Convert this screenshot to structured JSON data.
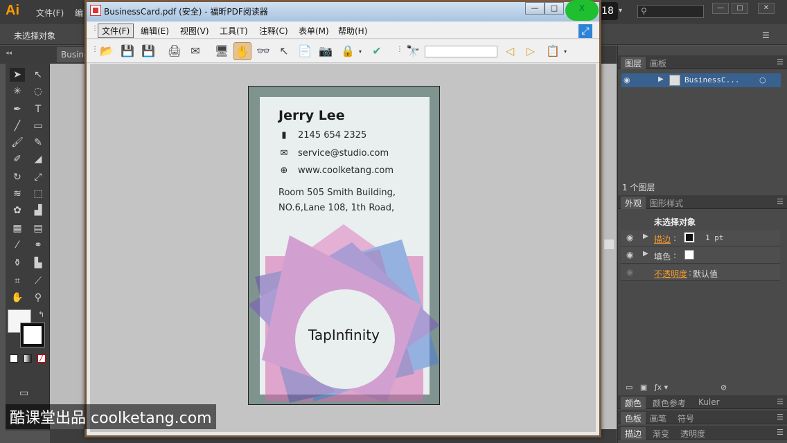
{
  "illustrator": {
    "logo": "Ai",
    "menus": [
      "文件(F)",
      "编"
    ],
    "counter": "18",
    "control_bar": {
      "no_selection": "未选择对象"
    },
    "doc_tab": "Busine",
    "tools": [
      "selection",
      "direct-selection",
      "magic-wand",
      "lasso",
      "pen",
      "type",
      "line",
      "rectangle",
      "paintbrush",
      "pencil",
      "blob-brush",
      "eraser",
      "rotate",
      "scale",
      "warp",
      "free-transform",
      "symbol-sprayer",
      "column-graph",
      "mesh",
      "gradient",
      "eyedropper",
      "blend",
      "live-paint",
      "graph",
      "artboard",
      "slice",
      "hand",
      "zoom"
    ],
    "layers_panel": {
      "tabs": [
        "图层",
        "画板"
      ],
      "layer_name": "BusinessC...",
      "count": "1 个图层"
    },
    "appearance_panel": {
      "tabs": [
        "外观",
        "图形样式"
      ],
      "title": "未选择对象",
      "stroke_label": "描边",
      "stroke_value": "1 pt",
      "fill_label": "填色",
      "opacity_label": "不透明度",
      "opacity_value": "默认值"
    },
    "bottom_tabs": [
      [
        "颜色",
        "颜色参考",
        "Kuler"
      ],
      [
        "色板",
        "画笔",
        "符号"
      ],
      [
        "描边",
        "渐变",
        "透明度"
      ]
    ]
  },
  "pdf_reader": {
    "title": "BusinessCard.pdf (安全) - 福昕PDF阅读器",
    "window_buttons": {
      "minimize": "—",
      "restore": "□",
      "close": "X"
    },
    "menus": [
      {
        "label": "文件(F)",
        "active": true
      },
      {
        "label": "编辑(E)"
      },
      {
        "label": "视图(V)"
      },
      {
        "label": "工具(T)"
      },
      {
        "label": "注释(C)"
      },
      {
        "label": "表单(M)"
      },
      {
        "label": "帮助(H)"
      }
    ],
    "find_value": ""
  },
  "business_card": {
    "name": "Jerry Lee",
    "phone": "2145 654 2325",
    "email": "service@studio.com",
    "website": "www.coolketang.com",
    "address_line1": "Room 505 Smith Building,",
    "address_line2": "NO.6,Lane 108, 1th Road,",
    "brand": "TapInfinity",
    "colors": {
      "frame": "#7f948f",
      "panel": "#e9eeee",
      "pink": "#e07fc0",
      "blue": "#4f80d6",
      "purple": "#6a4fae"
    }
  },
  "watermark": "酷课堂出品 coolketang.com"
}
